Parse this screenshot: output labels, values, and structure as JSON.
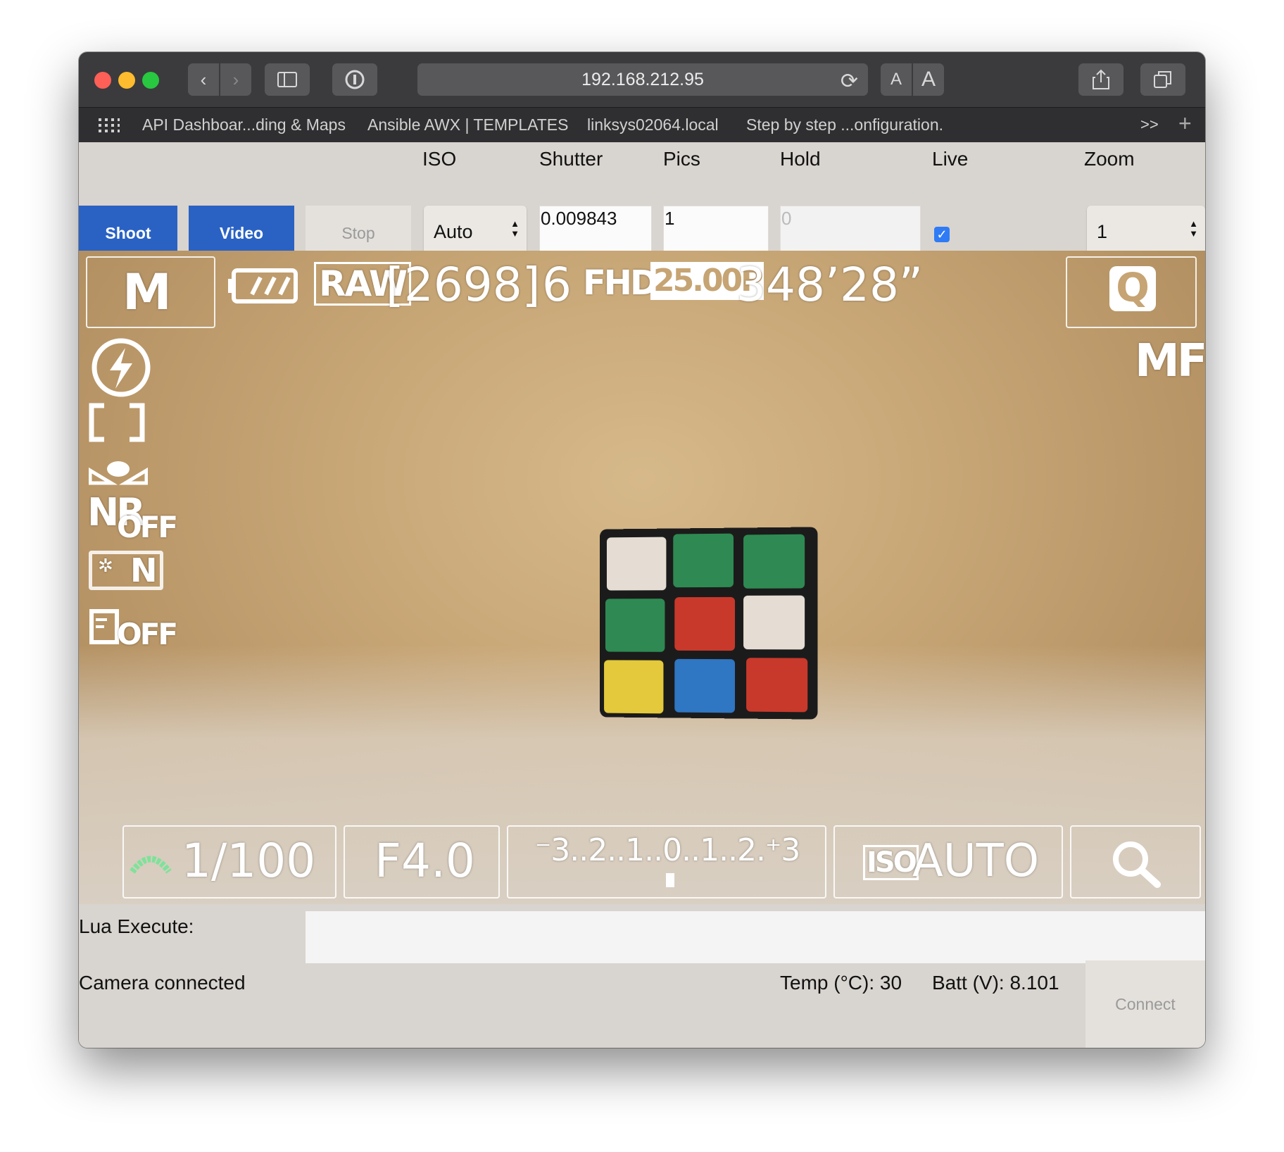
{
  "browser": {
    "address": "192.168.212.95",
    "text_size_small": "A",
    "text_size_large": "A",
    "bookmarks": [
      "API Dashboar...ding & Maps",
      "Ansible AWX | TEMPLATES",
      "linksys02064.local",
      "Step by step ...onfiguration."
    ],
    "overflow": ">>",
    "new_tab": "+"
  },
  "controls": {
    "labels": {
      "iso": "ISO",
      "shutter": "Shutter",
      "pics": "Pics",
      "hold": "Hold",
      "live": "Live",
      "zoom": "Zoom"
    },
    "shoot_label": "Shoot",
    "video_label": "Video",
    "stop_label": "Stop",
    "iso_value": "Auto",
    "shutter_value": "0.009843",
    "pics_value": "1",
    "hold_placeholder": "0",
    "live_checked": true,
    "zoom_value": "1"
  },
  "liveview": {
    "mode": "M",
    "format": "RAW",
    "shots_remaining": "[2698]",
    "shots_digit": "6",
    "video_res": "FHD",
    "frame_rate": "25.00P",
    "rec_time": "348’28”",
    "quick_label": "Q",
    "focus_mode": "MF",
    "nr_main": "NR",
    "nr_state": "OFF",
    "nr2_label": "N",
    "dlo_state": "OFF",
    "shutter_speed": "1/100",
    "aperture": "F4.0",
    "exposure_scale": "⁻3..2..1..0..1..2.⁺3",
    "iso_badge": "ISO",
    "iso_mode": "AUTO"
  },
  "bottom": {
    "lua_label": "Lua Execute:",
    "status": "Camera connected",
    "temp": "Temp (°C): 30",
    "batt": "Batt (V): 8.101",
    "connect_label": "Connect"
  }
}
